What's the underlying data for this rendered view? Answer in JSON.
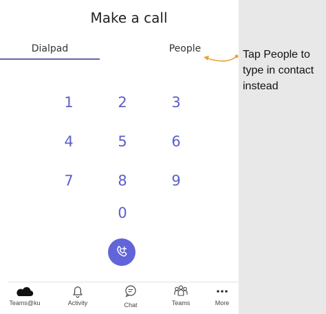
{
  "header": {
    "title": "Make a call"
  },
  "tabs": [
    {
      "label": "Dialpad",
      "active": true
    },
    {
      "label": "People",
      "active": false
    }
  ],
  "dialpad": {
    "keys": [
      "1",
      "2",
      "3",
      "4",
      "5",
      "6",
      "7",
      "8",
      "9",
      "0"
    ]
  },
  "call_button": {
    "icon": "phone-plus-icon"
  },
  "callout": {
    "text": "Tap People to type in contact instead"
  },
  "bottom_nav": [
    {
      "label": "Teams@ku",
      "icon": "cloud-icon"
    },
    {
      "label": "Activity",
      "icon": "bell-icon"
    },
    {
      "label": "Chat",
      "icon": "chat-icon"
    },
    {
      "label": "Teams",
      "icon": "teams-icon"
    },
    {
      "label": "More",
      "icon": "more-icon"
    }
  ],
  "colors": {
    "accent": "#6264a7",
    "key_text": "#5b5fc7",
    "callout_arrow": "#e8a23a",
    "side_panel": "#e8e8e8"
  }
}
